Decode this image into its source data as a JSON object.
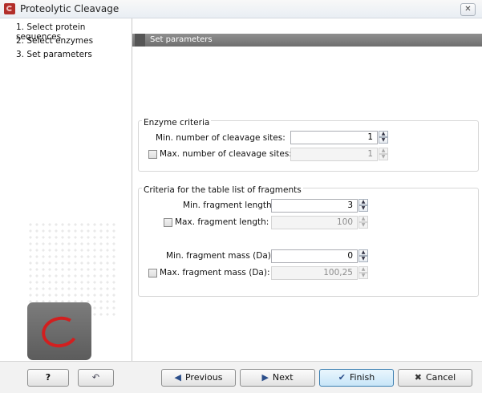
{
  "window": {
    "title": "Proteolytic Cleavage",
    "close_label": "✕"
  },
  "sidebar": {
    "items": [
      {
        "label": "1. Select protein sequences"
      },
      {
        "label": "2. Select enzymes"
      },
      {
        "label": "3. Set parameters"
      }
    ]
  },
  "panel": {
    "title": "Set parameters"
  },
  "enzyme_criteria": {
    "title": "Enzyme criteria",
    "min_sites_label": "Min. number of cleavage sites:",
    "min_sites_value": "1",
    "max_sites_label": "Max. number of cleavage sites:",
    "max_sites_value": "1",
    "max_sites_checked": false
  },
  "fragment_criteria": {
    "title": "Criteria for the table list of fragments",
    "min_length_label": "Min. fragment length:",
    "min_length_value": "3",
    "max_length_label": "Max. fragment length:",
    "max_length_value": "100",
    "max_length_checked": false,
    "min_mass_label": "Min. fragment mass (Da):",
    "min_mass_value": "0",
    "max_mass_label": "Max. fragment mass (Da):",
    "max_mass_value": "100,25",
    "max_mass_checked": false
  },
  "footer": {
    "help_label": "?",
    "reset_icon": "undo-arrow-icon",
    "previous_label": "Previous",
    "next_label": "Next",
    "finish_label": "Finish",
    "cancel_label": "Cancel"
  },
  "colors": {
    "header_bg": "#7a7a7a",
    "logo_red": "#d21f1f",
    "title_icon_red": "#b22e2a"
  }
}
